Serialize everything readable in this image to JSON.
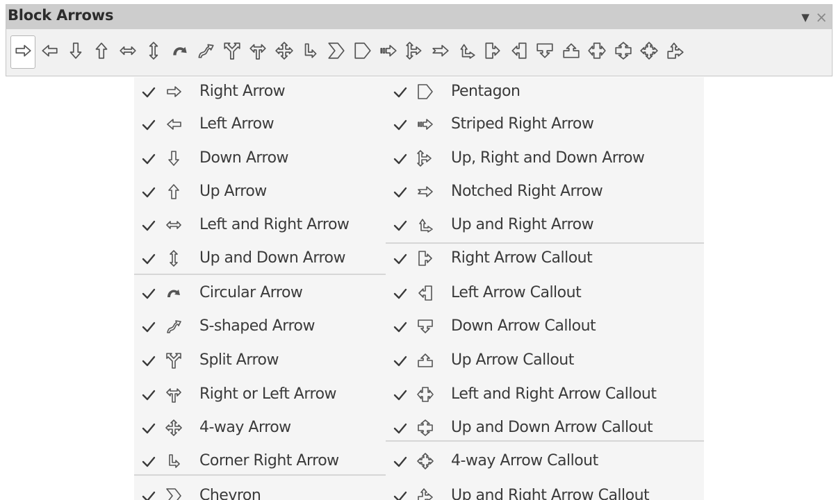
{
  "window": {
    "title": "Block Arrows",
    "menu_glyph": "▼",
    "close_glyph": "×"
  },
  "toolbar": {
    "icons": [
      "right-arrow-icon",
      "left-arrow-icon",
      "down-arrow-icon",
      "up-arrow-icon",
      "left-right-arrow-icon",
      "up-down-arrow-icon",
      "circular-arrow-icon",
      "s-shaped-arrow-icon",
      "split-arrow-icon",
      "right-or-left-arrow-icon",
      "four-way-arrow-icon",
      "corner-right-arrow-icon",
      "chevron-icon",
      "pentagon-icon",
      "striped-right-arrow-icon",
      "up-right-down-arrow-icon",
      "notched-right-arrow-icon",
      "up-and-right-arrow-icon",
      "right-arrow-callout-icon",
      "left-arrow-callout-icon",
      "down-arrow-callout-icon",
      "up-arrow-callout-icon",
      "left-right-arrow-callout-icon",
      "up-down-arrow-callout-icon",
      "four-way-arrow-callout-icon",
      "up-right-arrow-callout-icon"
    ]
  },
  "menu": {
    "left": [
      {
        "label": "Right Arrow",
        "icon": "right-arrow-icon",
        "checked": true
      },
      {
        "label": "Left Arrow",
        "icon": "left-arrow-icon",
        "checked": true
      },
      {
        "label": "Down Arrow",
        "icon": "down-arrow-icon",
        "checked": true
      },
      {
        "label": "Up Arrow",
        "icon": "up-arrow-icon",
        "checked": true
      },
      {
        "label": "Left and Right Arrow",
        "icon": "left-right-arrow-icon",
        "checked": true
      },
      {
        "label": "Up and Down Arrow",
        "icon": "up-down-arrow-icon",
        "checked": true
      },
      {
        "label": "Circular Arrow",
        "icon": "circular-arrow-icon",
        "checked": true
      },
      {
        "label": "S-shaped Arrow",
        "icon": "s-shaped-arrow-icon",
        "checked": true
      },
      {
        "label": "Split Arrow",
        "icon": "split-arrow-icon",
        "checked": true
      },
      {
        "label": "Right or Left Arrow",
        "icon": "right-or-left-arrow-icon",
        "checked": true
      },
      {
        "label": "4-way Arrow",
        "icon": "four-way-arrow-icon",
        "checked": true
      },
      {
        "label": "Corner Right Arrow",
        "icon": "corner-right-arrow-icon",
        "checked": true
      },
      {
        "label": "Chevron",
        "icon": "chevron-icon",
        "checked": true
      }
    ],
    "right": [
      {
        "label": "Pentagon",
        "icon": "pentagon-icon",
        "checked": true
      },
      {
        "label": "Striped Right Arrow",
        "icon": "striped-right-arrow-icon",
        "checked": true
      },
      {
        "label": "Up, Right and Down Arrow",
        "icon": "up-right-down-arrow-icon",
        "checked": true
      },
      {
        "label": "Notched Right Arrow",
        "icon": "notched-right-arrow-icon",
        "checked": true
      },
      {
        "label": "Up and Right Arrow",
        "icon": "up-and-right-arrow-icon",
        "checked": true
      },
      {
        "label": "Right Arrow Callout",
        "icon": "right-arrow-callout-icon",
        "checked": true
      },
      {
        "label": "Left Arrow Callout",
        "icon": "left-arrow-callout-icon",
        "checked": true
      },
      {
        "label": "Down Arrow Callout",
        "icon": "down-arrow-callout-icon",
        "checked": true
      },
      {
        "label": "Up Arrow Callout",
        "icon": "up-arrow-callout-icon",
        "checked": true
      },
      {
        "label": "Left and Right Arrow Callout",
        "icon": "left-right-arrow-callout-icon",
        "checked": true
      },
      {
        "label": "Up and Down Arrow Callout",
        "icon": "up-down-arrow-callout-icon",
        "checked": true
      },
      {
        "label": "4-way Arrow Callout",
        "icon": "four-way-arrow-callout-icon",
        "checked": true
      },
      {
        "label": "Up and Right Arrow Callout",
        "icon": "up-right-arrow-callout-icon",
        "checked": true
      }
    ]
  }
}
